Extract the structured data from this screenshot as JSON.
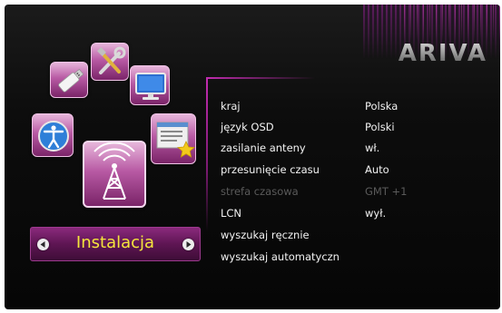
{
  "brand": {
    "logo_text": "ARIVA"
  },
  "colors": {
    "accent": "#c22cb0",
    "category_text": "#f5e63c",
    "text": "#f2f2f2",
    "disabled_text": "#5a5a5a"
  },
  "icon_wheel": [
    {
      "icon": "usb-drive-icon"
    },
    {
      "icon": "tools-icon"
    },
    {
      "icon": "monitor-icon"
    },
    {
      "icon": "accessibility-icon"
    },
    {
      "icon": "list-star-icon"
    },
    {
      "icon": "antenna-tower-icon"
    }
  ],
  "category": {
    "label": "Instalacja",
    "prev_icon": "chevron-left-icon",
    "next_icon": "chevron-right-icon"
  },
  "menu": {
    "items": [
      {
        "label": "kraj",
        "value": "Polska",
        "enabled": true
      },
      {
        "label": "język OSD",
        "value": "Polski",
        "enabled": true
      },
      {
        "label": "zasilanie anteny",
        "value": "wł.",
        "enabled": true
      },
      {
        "label": "przesunięcie czasu",
        "value": "Auto",
        "enabled": true
      },
      {
        "label": "strefa czasowa",
        "value": "GMT +1",
        "enabled": false
      },
      {
        "label": "LCN",
        "value": "wył.",
        "enabled": true
      },
      {
        "label": "wyszukaj ręcznie",
        "value": "",
        "enabled": true
      },
      {
        "label": "wyszukaj automatyczn",
        "value": "",
        "enabled": true
      }
    ]
  }
}
